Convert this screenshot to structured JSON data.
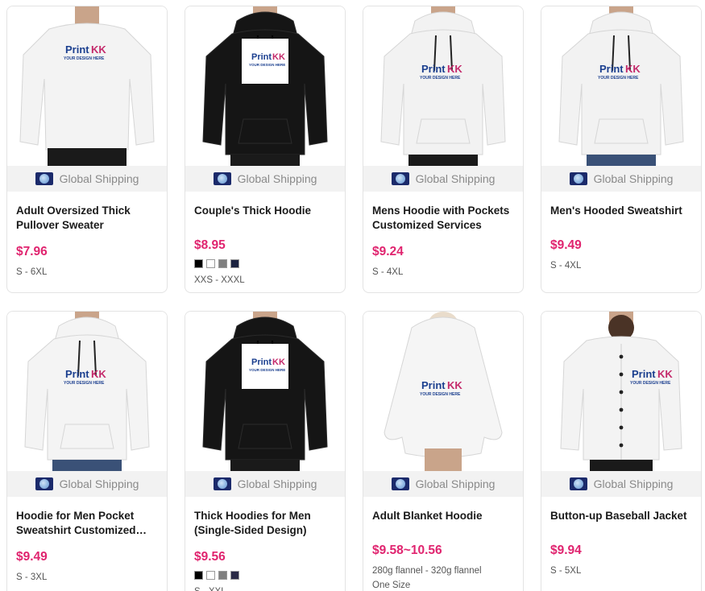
{
  "shipping_label": "Global Shipping",
  "products": [
    {
      "title": "Adult Oversized Thick Pullover Sweater",
      "price": "$7.96",
      "sizes": "S - 6XL",
      "swatches": [],
      "extra": "",
      "garment": "sweater",
      "garment_color": "#f3f3f3"
    },
    {
      "title": "Couple's Thick Hoodie",
      "price": "$8.95",
      "sizes": "XXS - XXXL",
      "swatches": [
        "#000000",
        "#ffffff",
        "#7f7f7f",
        "#1c2340"
      ],
      "extra": "",
      "garment": "hoodie",
      "garment_color": "#151515"
    },
    {
      "title": "Mens Hoodie with Pockets Customized Services",
      "price": "$9.24",
      "sizes": "S - 4XL",
      "swatches": [],
      "extra": "",
      "garment": "hoodie",
      "garment_color": "#f2f2f2"
    },
    {
      "title": "Men's Hooded Sweatshirt",
      "price": "$9.49",
      "sizes": "S - 4XL",
      "swatches": [],
      "extra": "",
      "garment": "hoodie",
      "garment_color": "#f2f2f2"
    },
    {
      "title": "Hoodie for Men Pocket Sweatshirt Customized Services",
      "price": "$9.49",
      "sizes": "S - 3XL",
      "swatches": [],
      "extra": "",
      "garment": "hoodie",
      "garment_color": "#f4f4f4"
    },
    {
      "title": "Thick Hoodies for Men (Single-Sided Design)",
      "price": "$9.56",
      "sizes": "S - XXL",
      "swatches": [
        "#000000",
        "#ffffff",
        "#7f7f7f",
        "#2a2a45"
      ],
      "extra": "",
      "garment": "hoodie",
      "garment_color": "#151515"
    },
    {
      "title": "Adult Blanket Hoodie",
      "price": "$9.58~10.56",
      "sizes": "280g flannel - 320g flannel",
      "swatches": [],
      "extra": "One Size",
      "garment": "blanket",
      "garment_color": "#f5f5f5"
    },
    {
      "title": "Button-up Baseball Jacket",
      "price": "$9.94",
      "sizes": "S - 5XL",
      "swatches": [],
      "extra": "",
      "garment": "jacket",
      "garment_color": "#f3f3f3"
    }
  ],
  "print_logo": {
    "brand": "Print",
    "brand_mark": "KK",
    "tagline": "YOUR DESIGN HERE"
  },
  "colors": {
    "price": "#e0246f",
    "shipping_bg": "#f2f2f2",
    "card_border": "#e3e3e3"
  }
}
